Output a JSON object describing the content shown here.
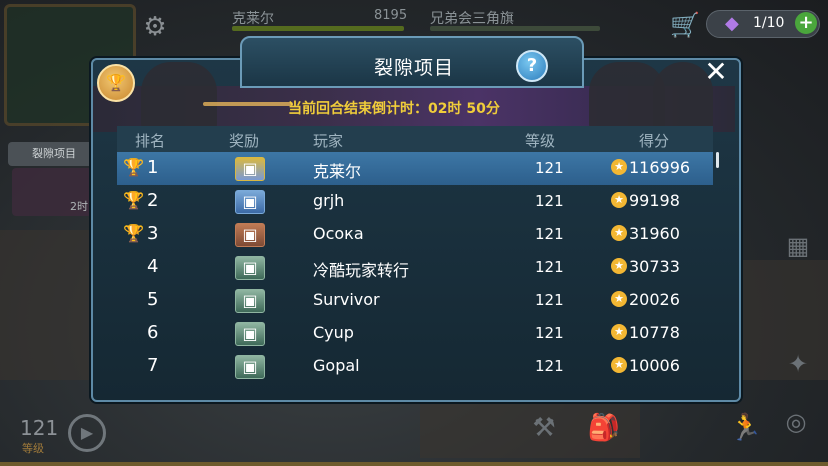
{
  "hud": {
    "player_name": "克莱尔",
    "score": "8195",
    "guild_name": "兄弟会三角旗",
    "energy": "1/10",
    "plus_label": "+",
    "left_tab_label": "裂隙项目",
    "left_thumb_timer": "2时",
    "level_value": "121",
    "level_label": "等级"
  },
  "dialog": {
    "title": "裂隙项目",
    "help_label": "?",
    "close_label": "✕",
    "countdown": "当前回合结束倒计时：02时 50分",
    "columns": [
      "排名",
      "奖励",
      "玩家",
      "等级",
      "得分"
    ]
  },
  "leaderboard": [
    {
      "rank": "1",
      "cup": "gold-cup-icon",
      "reward": "gold-crate-icon",
      "player": "克莱尔",
      "level": "121",
      "score": "116996",
      "selected": true
    },
    {
      "rank": "2",
      "cup": "silver-cup-icon",
      "reward": "blue-crate-icon",
      "player": "grjh",
      "level": "121",
      "score": "99198"
    },
    {
      "rank": "3",
      "cup": "bronze-cup-icon",
      "reward": "bronze-crate-icon",
      "player": "Осока",
      "level": "121",
      "score": "31960"
    },
    {
      "rank": "4",
      "cup": "",
      "reward": "green-crate-icon",
      "player": "冷酷玩家转行",
      "level": "121",
      "score": "30733"
    },
    {
      "rank": "5",
      "cup": "",
      "reward": "green-crate-icon",
      "player": "Survivor",
      "level": "121",
      "score": "20026"
    },
    {
      "rank": "6",
      "cup": "",
      "reward": "green-crate-icon",
      "player": "Cyup",
      "level": "121",
      "score": "10778"
    },
    {
      "rank": "7",
      "cup": "",
      "reward": "green-crate-icon",
      "player": "Gopal",
      "level": "121",
      "score": "10006"
    }
  ],
  "colors": {
    "countdown": "#f0cd3a",
    "selected_row": "#3d77a6",
    "gold_cup": "#f2c14e",
    "silver_cup": "#c9d0d6",
    "bronze_cup": "#c98a4a"
  }
}
